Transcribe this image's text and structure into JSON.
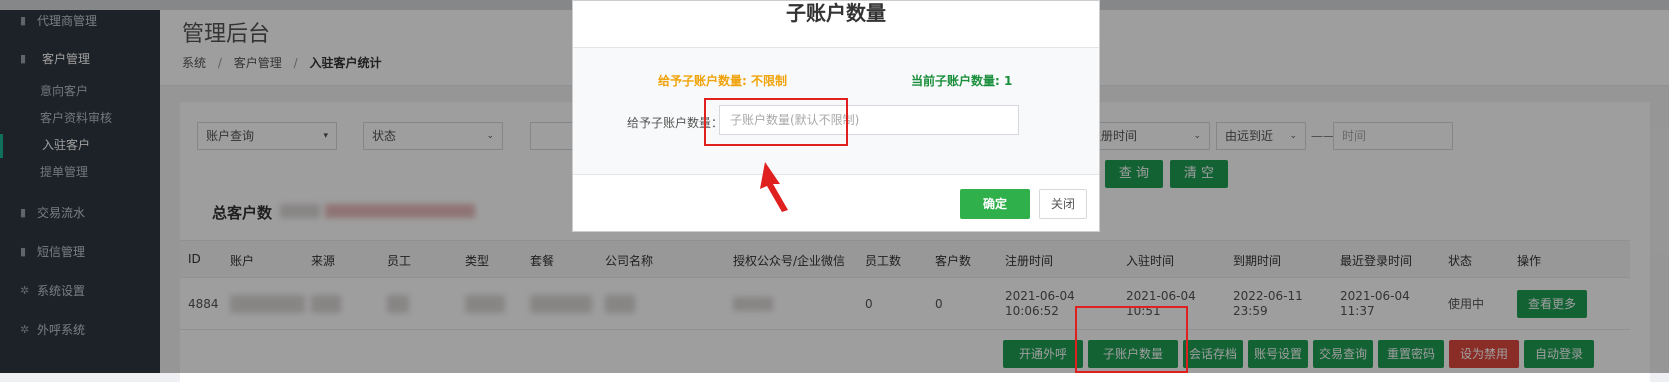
{
  "sidebar": {
    "items": [
      {
        "label": "代理商管理",
        "icon": "book-icon"
      },
      {
        "label": "客户管理",
        "icon": "book-icon"
      },
      {
        "label": "交易流水",
        "icon": "book-icon"
      },
      {
        "label": "短信管理",
        "icon": "book-icon"
      },
      {
        "label": "系统设置",
        "icon": "gear-icon"
      },
      {
        "label": "外呼系统",
        "icon": "gear-icon"
      }
    ],
    "sub_items": [
      "意向客户",
      "客户资料审核",
      "入驻客户",
      "提单管理"
    ],
    "active_sub": "入驻客户"
  },
  "header": {
    "title": "管理后台",
    "breadcrumb": [
      "系统",
      "客户管理",
      "入驻客户统计"
    ],
    "breadcrumb_sep": "/"
  },
  "filters": {
    "account_query": "账户查询",
    "status": "状态",
    "register_time": "注册时间",
    "sort": "由远到近",
    "range_sep": "——",
    "time_placeholder": "时间",
    "query_button": "查 询",
    "clear_button": "清 空"
  },
  "summary": {
    "total_label": "总客户数"
  },
  "table": {
    "columns": [
      "ID",
      "账户",
      "来源",
      "员工",
      "类型",
      "套餐",
      "公司名称",
      "授权公众号/企业微信",
      "员工数",
      "客户数",
      "注册时间",
      "入驻时间",
      "到期时间",
      "最近登录时间",
      "状态",
      "操作"
    ],
    "rows": [
      {
        "id": "4884",
        "staff_count": "0",
        "customer_count": "0",
        "register_date": "2021-06-04",
        "register_time": "10:06:52",
        "join_date": "2021-06-04",
        "join_time": "10:51",
        "expire_date": "2022-06-11",
        "expire_time": "23:59",
        "last_login_date": "2021-06-04",
        "last_login_time": "11:37",
        "status": "使用中",
        "more_button": "查看更多"
      }
    ],
    "actions": [
      "开通外呼",
      "子账户数量",
      "会话存档",
      "账号设置",
      "交易查询",
      "重置密码",
      "设为禁用",
      "自动登录"
    ]
  },
  "modal": {
    "title": "子账户数量",
    "given_label": "给予子账户数量: 不限制",
    "current_label": "当前子账户数量: 1",
    "field_label": "给予子账户数量：",
    "field_placeholder": "子账户数量(默认不限制)",
    "confirm_button": "确定",
    "close_button": "关闭"
  },
  "colors": {
    "sidebar_bg": "#2f3741",
    "accent_green": "#1e9e54",
    "warn_orange": "#f0a30a",
    "danger_red": "#e04a3f",
    "highlight_red": "#e01f1f"
  }
}
